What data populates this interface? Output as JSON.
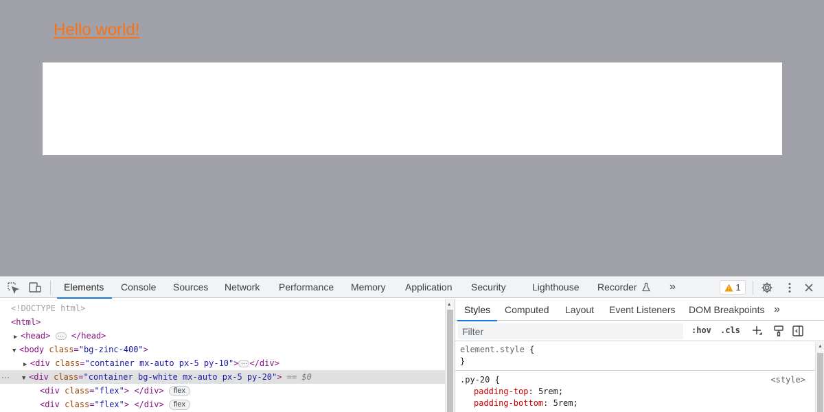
{
  "page": {
    "hello_text": "Hello world!",
    "colors": {
      "background": "#a1a1aa",
      "hello": "#f97316",
      "box": "#ffffff"
    }
  },
  "devtools": {
    "left_icons": [
      "inspect-element-icon",
      "device-toolbar-icon"
    ],
    "tabs": [
      "Elements",
      "Console",
      "Sources",
      "Network",
      "Performance",
      "Memory",
      "Application",
      "Security",
      "Lighthouse",
      "Recorder"
    ],
    "active_tab": "Elements",
    "more_tabs_symbol": "»",
    "warning_count": "1",
    "right_icons": [
      "settings-icon",
      "more-vertical-icon",
      "close-icon"
    ],
    "dom": {
      "doctype": "<!DOCTYPE html>",
      "html_tag": "<html>",
      "head_open": "<head>",
      "head_close": "</head>",
      "body_tag": "<body",
      "body_attr": "class",
      "body_val": "\"bg-zinc-400\"",
      "div_tag": "<div",
      "div_close": "</div>",
      "class_attr": "class",
      "div1_val": "\"container mx-auto px-5 py-10\"",
      "div2_val": "\"container bg-white mx-auto px-5 py-20\"",
      "selected_marker": "== $0",
      "gutter_dots": "···",
      "flex_val": "\"flex\"",
      "flex_badge": "flex"
    },
    "styles": {
      "subtabs": [
        "Styles",
        "Computed",
        "Layout",
        "Event Listeners",
        "DOM Breakpoints"
      ],
      "active_subtab": "Styles",
      "more_symbol": "»",
      "filter_placeholder": "Filter",
      "hov": ":hov",
      "cls": ".cls",
      "element_style_selector": "element.style",
      "open_brace": " {",
      "close_brace": "}",
      "rule_selector": ".py-20",
      "rule_source": "<style>",
      "properties": [
        {
          "name": "padding-top",
          "value": "5rem"
        },
        {
          "name": "padding-bottom",
          "value": "5rem"
        }
      ]
    }
  }
}
